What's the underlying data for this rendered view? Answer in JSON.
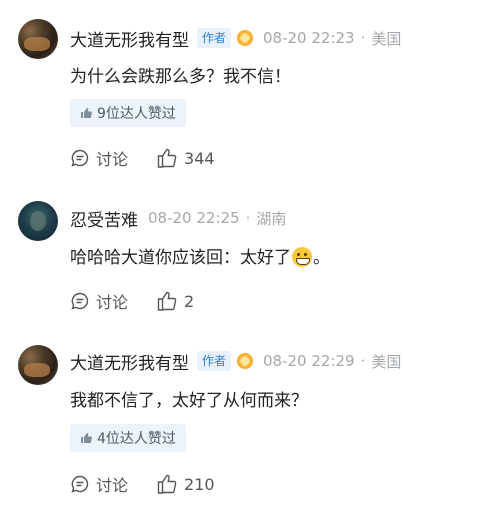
{
  "comments": [
    {
      "name": "大道无形我有型",
      "author_tag": "作者",
      "time": "08-20 22:23",
      "location": "美国",
      "text": "为什么会跌那么多？我不信！",
      "likes_chip": "9位达人赞过",
      "discuss_label": "讨论",
      "like_count": "344"
    },
    {
      "name": "忍受苦难",
      "time": "08-20 22:25",
      "location": "湖南",
      "text_before": "哈哈哈大道你应该回：太好了",
      "text_after": "。",
      "emoji": "grin-emoji",
      "discuss_label": "讨论",
      "like_count": "2"
    },
    {
      "name": "大道无形我有型",
      "author_tag": "作者",
      "time": "08-20 22:29",
      "location": "美国",
      "text": "我都不信了，太好了从何而来？",
      "likes_chip": "4位达人赞过",
      "discuss_label": "讨论",
      "like_count": "210"
    }
  ],
  "separator": "·",
  "colors": {
    "author_tag": "#2f7fd8",
    "meta": "#a4a8ad",
    "chip_bg": "#edf3fb"
  }
}
